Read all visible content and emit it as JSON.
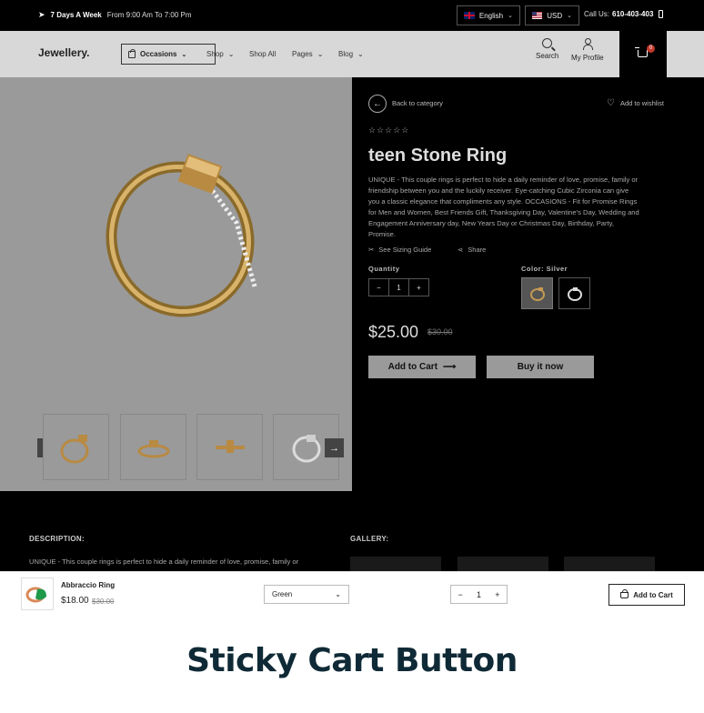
{
  "topbar": {
    "ship_bold": "7 Days A Week",
    "ship_hours": "From 9:00 Am To 7:00 Pm",
    "language": "English",
    "currency": "USD",
    "call_label": "Call Us:",
    "call_number": "610-403-403"
  },
  "header": {
    "logo": "Jewellery.",
    "occasions": "Occasions",
    "nav": [
      "Shop",
      "Shop All",
      "Pages",
      "Blog"
    ],
    "search_label": "Search",
    "profile_label": "My Profile",
    "cart_count": "0"
  },
  "product": {
    "back_label": "Back to category",
    "wishlist_label": "Add to wishlist",
    "stars": "☆☆☆☆☆",
    "title": "teen Stone Ring",
    "description": "UNIQUE - This couple rings is perfect to hide a daily reminder of love, promise, family or friendship between you and the luckily receiver. Eye-catching Cubic Zirconia can give you a classic elegance that compliments any style. OCCASIONS - Fit for Promise Rings for Men and Women, Best Friends Gift, Thanksgiving Day, Valentine's Day, Wedding and Engagement Anniversary day, New Years Day or Christmas Day, Birthday, Party, Promise.",
    "sizing_label": "See Sizing Guide",
    "share_label": "Share",
    "quantity_label": "Quantity",
    "quantity": "1",
    "color_label": "Color: Silver",
    "price": "$25.00",
    "old_price": "$30.00",
    "add_to_cart": "Add to Cart",
    "buy_now": "Buy it now"
  },
  "details_section": {
    "description_heading": "DESCRIPTION:",
    "gallery_heading": "GALLERY:",
    "description_text": "UNIQUE - This couple rings is perfect to hide a daily reminder of love, promise, family or"
  },
  "sticky_bar": {
    "name": "Abbraccio Ring",
    "price": "$18.00",
    "old_price": "$30.00",
    "variant": "Green",
    "quantity": "1",
    "add_to_cart": "Add to Cart"
  },
  "caption": "Sticky Cart Button"
}
